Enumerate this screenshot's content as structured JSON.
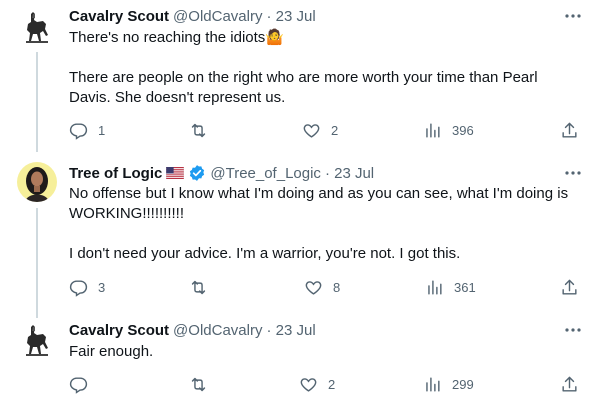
{
  "tweets": [
    {
      "name": "Cavalry Scout",
      "handle": "@OldCavalry",
      "date": "· 23 Jul",
      "lines": [
        "There's no reaching the idiots🤷‍♂️",
        "",
        "There are people on the right who are more worth your time than Pearl",
        "Davis. She doesn't represent us."
      ],
      "text1": "There's no reaching the idiots",
      "emoji": "🤷",
      "text2": "There are people on the right who are more worth your time than Pearl Davis. She doesn't represent us.",
      "replies": "1",
      "retweets": "",
      "likes": "2",
      "views": "396"
    },
    {
      "name": "Tree of Logic",
      "handle": "@Tree_of_Logic",
      "date": "· 23 Jul",
      "text1": "No offense but I know what I'm doing and as you can see, what I'm doing is WORKING!!!!!!!!!!",
      "text2": "I don't need your advice. I'm a warrior, you're not. I got this.",
      "replies": "3",
      "retweets": "",
      "likes": "8",
      "views": "361"
    },
    {
      "name": "Cavalry Scout",
      "handle": "@OldCavalry",
      "date": "· 23 Jul",
      "text1": "Fair enough.",
      "replies": "",
      "retweets": "",
      "likes": "2",
      "views": "299"
    }
  ],
  "icons": {
    "reply": "reply-icon",
    "retweet": "retweet-icon",
    "like": "heart-icon",
    "views": "views-icon",
    "share": "share-icon",
    "more": "more-icon",
    "verified": "verified-badge-icon",
    "flag": "us-flag-icon"
  },
  "colors": {
    "secondary_text": "#536471",
    "verified": "#1d9bf0",
    "thread_line": "#cfd9de"
  }
}
